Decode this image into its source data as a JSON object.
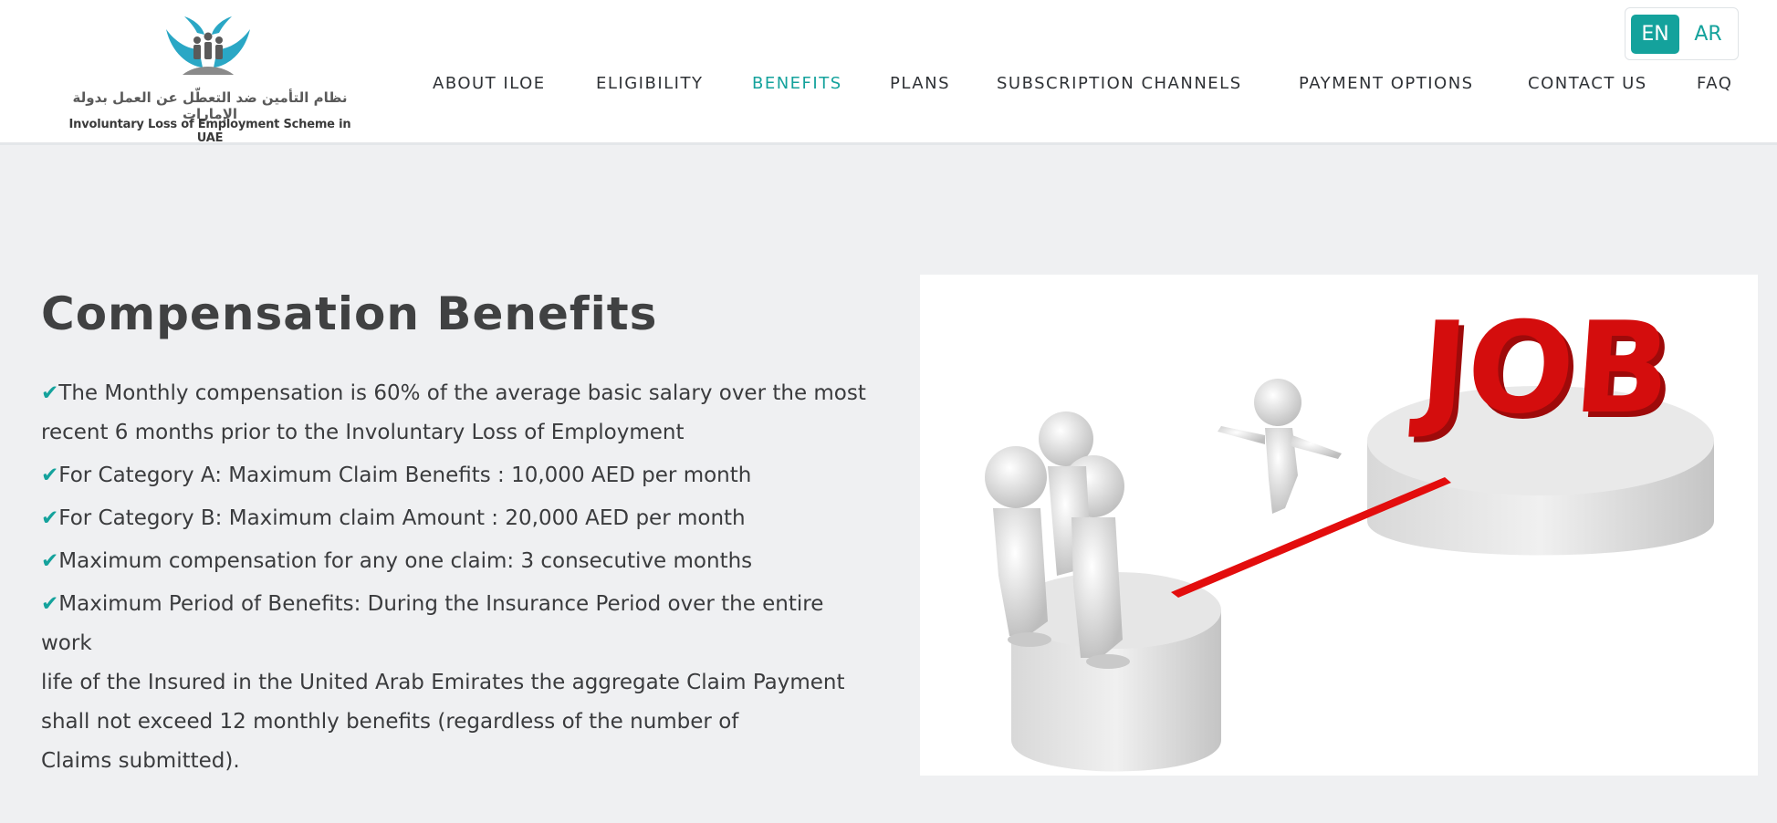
{
  "header": {
    "logo": {
      "arabic_text": "نظام التأمين ضد التعطّل عن العمل بدولة الإمارات",
      "english_text": "Involuntary Loss of Employment Scheme in UAE",
      "icon": "people-hands-logo"
    },
    "language": {
      "en_label": "EN",
      "ar_label": "AR",
      "selected": "EN"
    },
    "nav": [
      {
        "label": "ABOUT ILOE"
      },
      {
        "label": "ELIGIBILITY"
      },
      {
        "label": "BENEFITS",
        "active": true
      },
      {
        "label": "PLANS"
      },
      {
        "label": "SUBSCRIPTION CHANNELS"
      },
      {
        "label": "PAYMENT OPTIONS"
      },
      {
        "label": "CONTACT US"
      },
      {
        "label": "FAQ"
      }
    ]
  },
  "main": {
    "title": "Compensation Benefits",
    "benefits": [
      {
        "lines": [
          "The Monthly compensation is 60% of the average basic salary over the most",
          "recent 6 months prior to the Involuntary Loss of Employment"
        ]
      },
      {
        "lines": [
          "For Category A: Maximum Claim Benefits : 10,000 AED per month"
        ]
      },
      {
        "lines": [
          "For Category B: Maximum claim Amount : 20,000 AED per month"
        ]
      },
      {
        "lines": [
          "Maximum compensation for any one claim: 3 consecutive months"
        ]
      },
      {
        "lines": [
          "Maximum Period of Benefits: During the Insurance Period over the entire work",
          "life of the Insured in the United Arab Emirates the aggregate Claim Payment",
          "shall not exceed 12 monthly benefits (regardless of the number of",
          "Claims submitted)."
        ]
      }
    ],
    "image": {
      "word": "JOB",
      "icon": "job-bridge-illustration"
    }
  },
  "colors": {
    "accent": "#14a29c",
    "title": "#404142",
    "job_red": "#d40d0d",
    "page_bg": "#eff0f2"
  }
}
